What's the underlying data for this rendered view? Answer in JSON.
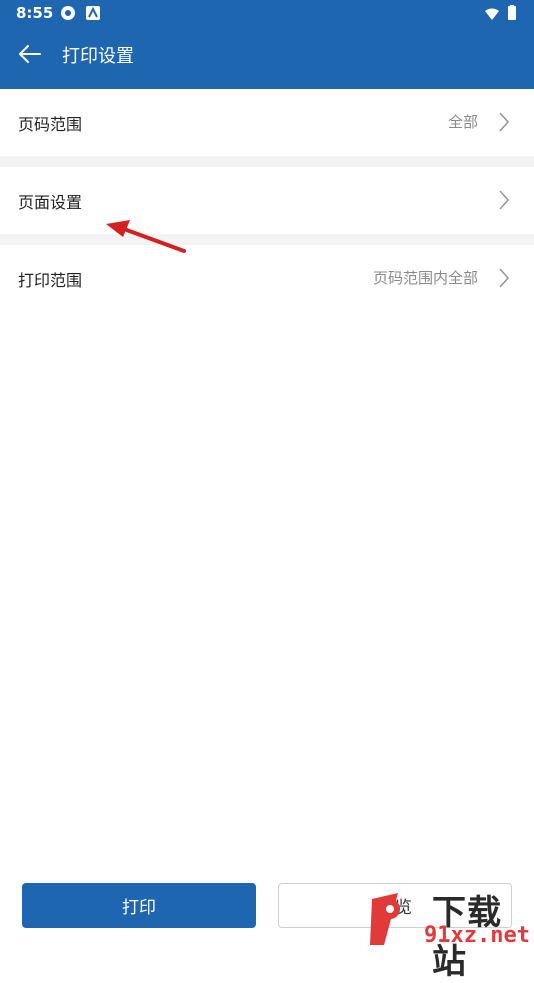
{
  "status_bar": {
    "time": "8:55"
  },
  "header": {
    "title": "打印设置"
  },
  "rows": [
    {
      "label": "页码范围",
      "value": "全部"
    },
    {
      "label": "页面设置",
      "value": ""
    },
    {
      "label": "打印范围",
      "value": "页码范围内全部"
    }
  ],
  "buttons": {
    "print": "打印",
    "preview": "预览"
  },
  "watermark": {
    "text_cn": "下载站",
    "text_url": "91xz.net"
  },
  "colors": {
    "accent": "#1f66b0",
    "annotation_arrow": "#d42020"
  },
  "icons": [
    "wifi-icon",
    "battery-icon",
    "back-arrow-icon",
    "chevron-right-icon"
  ]
}
